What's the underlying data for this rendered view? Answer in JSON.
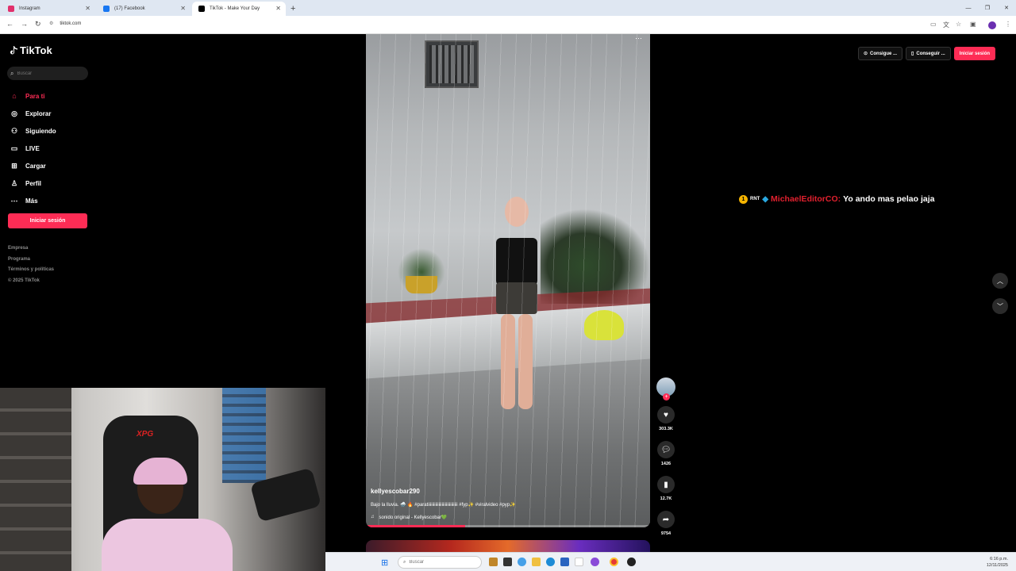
{
  "browser": {
    "tabs": [
      {
        "label": "Instagram",
        "favicon_color": "#e1306c",
        "active": false
      },
      {
        "label": "(17) Facebook",
        "favicon_color": "#1877f2",
        "active": false
      },
      {
        "label": "TikTok - Make Your Day",
        "favicon_color": "#000000",
        "active": true
      }
    ],
    "url": "tiktok.com"
  },
  "sidebar": {
    "logo": "TikTok",
    "search_placeholder": "Buscar",
    "items": [
      {
        "label": "Para ti",
        "icon": "home-icon",
        "active": true
      },
      {
        "label": "Explorar",
        "icon": "compass-icon",
        "active": false
      },
      {
        "label": "Siguiendo",
        "icon": "user-follow-icon",
        "active": false
      },
      {
        "label": "LIVE",
        "icon": "live-icon",
        "active": false
      },
      {
        "label": "Cargar",
        "icon": "upload-icon",
        "active": false
      },
      {
        "label": "Perfil",
        "icon": "profile-icon",
        "active": false
      },
      {
        "label": "Más",
        "icon": "more-icon",
        "active": false
      }
    ],
    "login_button": "Iniciar sesión",
    "footer": [
      "Empresa",
      "Programa",
      "Términos y políticas",
      "© 2025 TikTok"
    ]
  },
  "topbar": {
    "coins_button": "Consigue ...",
    "app_button": "Conseguir ...",
    "login_button": "Iniciar sesión"
  },
  "video": {
    "username": "kellyescobar290",
    "description": "Bajo la lluvia. 🌧️ 🔥 #paratiiiiiiiiiiiiiiiiiiiiiiiiiiii #fyp✨ #viralvideo #pyp✨",
    "sound": "sonido original - Kellyescobar💚",
    "progress_fraction": 0.35
  },
  "actions": {
    "likes": "303.3K",
    "comments": "1426",
    "saves": "12.7K",
    "shares": "9754"
  },
  "chat_overlay": {
    "badge": "1",
    "badge_tag": "RNT",
    "user": "MichaelEditorCO:",
    "message": "Yo ando mas pelao jaja"
  },
  "webcam": {
    "chair_brand": "XPG"
  },
  "taskbar": {
    "search_placeholder": "Buscar",
    "time": "6:16 p.m.",
    "date": "12/11/2025"
  },
  "colors": {
    "accent": "#fe2c55",
    "chat_user": "#e0202e"
  }
}
